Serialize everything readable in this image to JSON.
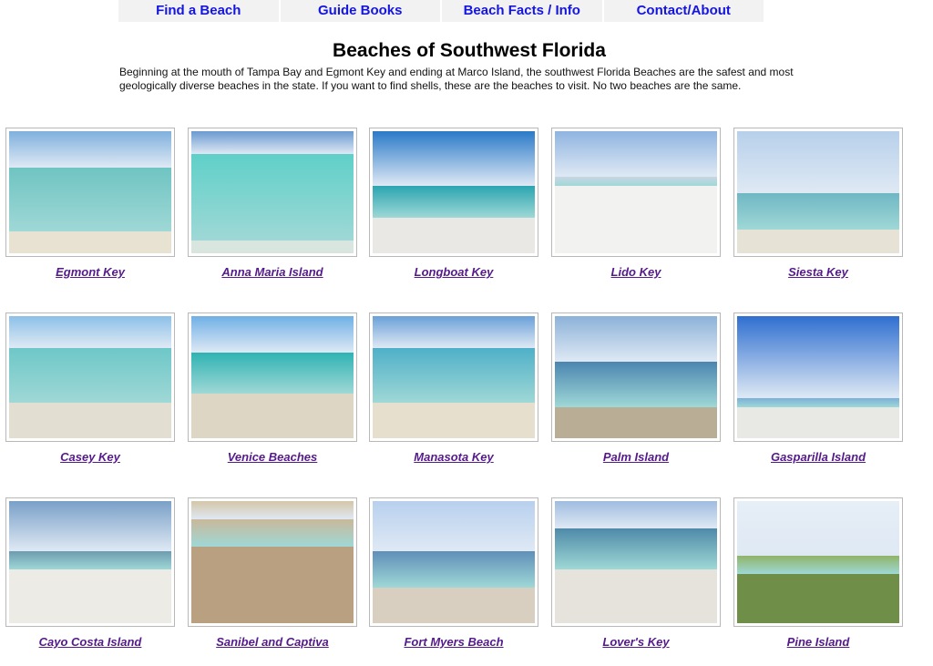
{
  "nav": [
    "Find a Beach",
    "Guide Books",
    "Beach Facts / Info",
    "Contact/About"
  ],
  "page": {
    "title": "Beaches of Southwest Florida",
    "intro": "Beginning at the mouth of Tampa Bay and Egmont Key and ending at Marco Island, the southwest Florida Beaches are the safest and most geologically diverse beaches in the state. If you want to find shells, these are the beaches to visit. No two beaches are the same."
  },
  "beaches": [
    {
      "name": "Egmont Key",
      "photo": "beach-photo"
    },
    {
      "name": "Anna Maria Island",
      "photo": "clear-water-photo"
    },
    {
      "name": "Longboat Key",
      "photo": "sandbar-photo"
    },
    {
      "name": "Lido Key",
      "photo": "beach-hotels-photo"
    },
    {
      "name": "Siesta Key",
      "photo": "lifeguard-tower-photo"
    },
    {
      "name": "Casey Key",
      "photo": "swimmers-photo"
    },
    {
      "name": "Venice Beaches",
      "photo": "shoreline-photo"
    },
    {
      "name": "Manasota Key",
      "photo": "fisherman-photo"
    },
    {
      "name": "Palm Island",
      "photo": "beach-houses-photo"
    },
    {
      "name": "Gasparilla Island",
      "photo": "lighthouse-photo"
    },
    {
      "name": "Cayo Costa Island",
      "photo": "island-shore-photo"
    },
    {
      "name": "Sanibel and Captiva",
      "photo": "seashells-photo"
    },
    {
      "name": "Fort Myers Beach",
      "photo": "crowded-beach-photo"
    },
    {
      "name": "Lover's Key",
      "photo": "canoe-photo"
    },
    {
      "name": "Pine Island",
      "photo": "palm-tree-photo"
    }
  ]
}
